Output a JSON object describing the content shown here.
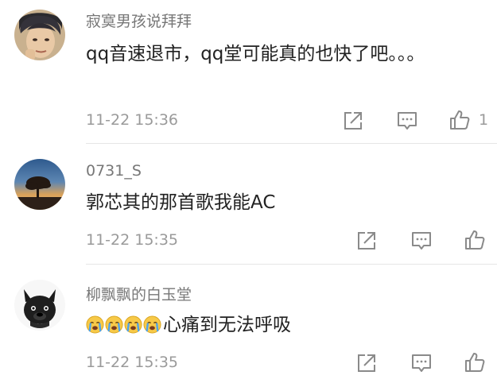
{
  "comments": [
    {
      "username": "寂寞男孩说拜拜",
      "text": "qq音速退市，qq堂可能真的也快了吧。。。",
      "time": "11-22 15:36",
      "like_count": "1"
    },
    {
      "username": "0731_S",
      "text": "郭芯其的那首歌我能AC",
      "time": "11-22 15:35"
    },
    {
      "username": "柳飘飘的白玉堂",
      "emoji_count": 4,
      "text": "心痛到无法呼吸",
      "time": "11-22 15:35"
    }
  ],
  "icons": {
    "share": "share-icon",
    "reply": "comment-icon",
    "like": "thumbs-up-icon",
    "emoji": "crying-face-emoji"
  },
  "colors": {
    "username": "#777777",
    "text": "#222222",
    "meta": "#9a9a9a",
    "icon": "#8a8a8a",
    "divider": "#e6e6e6"
  }
}
